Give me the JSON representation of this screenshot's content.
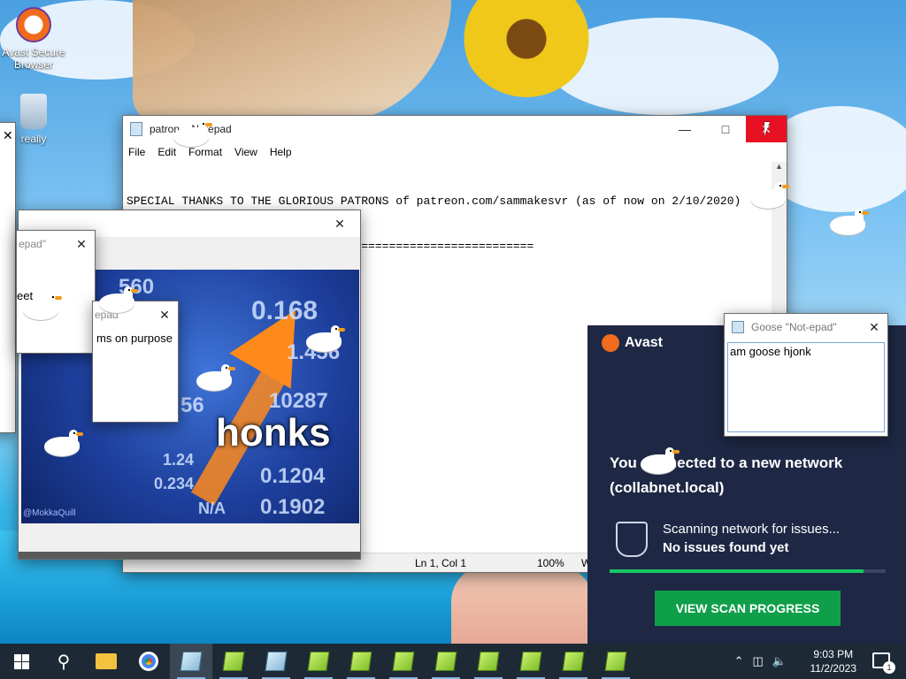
{
  "desktop": {
    "icons": [
      {
        "label": "Avast Secure Browser"
      },
      {
        "label": "really"
      }
    ]
  },
  "notepad_main": {
    "title": "patron... Notepad",
    "menu": [
      "File",
      "Edit",
      "Format",
      "View",
      "Help"
    ],
    "text_line1": "SPECIAL THANKS TO THE GLORIOUS PATRONS of patreon.com/sammakesvr (as of now on 2/10/2020)",
    "text_line2": " ==========================================================",
    "status": {
      "position": "Ln 1, Col 1",
      "zoom": "100%",
      "encoding": "W"
    }
  },
  "meme_window": {
    "caption": "honks",
    "credit": "@MokkaQuill",
    "numbers": [
      "0.168",
      "1.456",
      "10287",
      "0.1204",
      "0.1902",
      "0.234",
      "1.24",
      "N/A",
      "560",
      "56"
    ]
  },
  "small_notepads": [
    {
      "title": "epad\"",
      "text": "eet"
    },
    {
      "title": "epad\"",
      "text": "ms on purpose"
    }
  ],
  "goose_notepad": {
    "title": "Goose \"Not-epad\"",
    "text": "am goose hjonk"
  },
  "avast_popup": {
    "brand": "Avast",
    "headline": "You connected to a new network (collabnet.local)",
    "scan_status": "Scanning network for issues...",
    "scan_result": "No issues found yet",
    "progress": 0.92,
    "cta": "VIEW SCAN PROGRESS",
    "colors": {
      "accent": "#f06b1c",
      "cta": "#0f9f4a",
      "progress": "#17c964"
    }
  },
  "taskbar": {
    "time": "9:03 PM",
    "date": "11/2/2023",
    "notification_count": "1"
  }
}
